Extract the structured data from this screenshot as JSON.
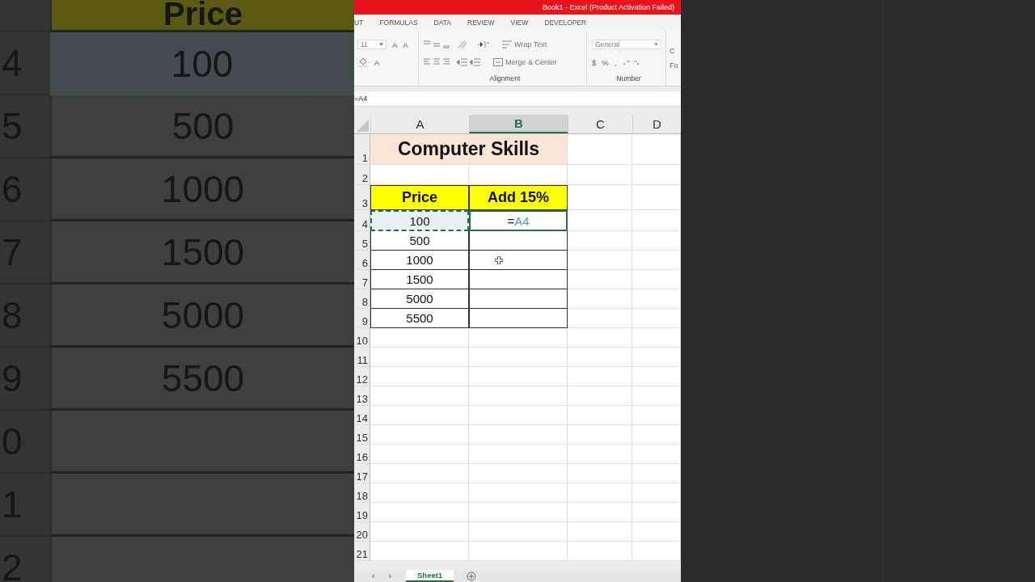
{
  "backdrop": {
    "header": "Price",
    "rows": [
      {
        "number": "4",
        "value": "100",
        "marquee": true
      },
      {
        "number": "5",
        "value": "500",
        "marquee": false
      },
      {
        "number": "6",
        "value": "1000",
        "marquee": false
      },
      {
        "number": "7",
        "value": "1500",
        "marquee": false
      },
      {
        "number": "8",
        "value": "5000",
        "marquee": false
      },
      {
        "number": "9",
        "value": "5500",
        "marquee": false
      },
      {
        "number": "0",
        "marquee": false
      },
      {
        "number": "1",
        "marquee": false
      },
      {
        "number": "2",
        "marquee": false
      }
    ]
  },
  "window": {
    "title": "Book1 -  Excel (Product Activation Failed)"
  },
  "ribbon_tabs": [
    {
      "label": "UT"
    },
    {
      "label": "FORMULAS"
    },
    {
      "label": "DATA"
    },
    {
      "label": "REVIEW"
    },
    {
      "label": "VIEW"
    },
    {
      "label": "DEVELOPER"
    }
  ],
  "ribbon": {
    "font_size": "11",
    "grow_font": "A",
    "shrink_font": "A",
    "font_color": "A",
    "wrap_text": "Wrap Text",
    "merge_center": "Merge & Center",
    "number_format": "General",
    "currency": "$",
    "percent": "%",
    "comma": ",",
    "alignment_label": "Alignment",
    "number_label": "Number",
    "cut_group": [
      "C",
      "Fo"
    ]
  },
  "formula_bar": {
    "value": "=A4"
  },
  "columns": [
    {
      "label": "A",
      "selected": false
    },
    {
      "label": "B",
      "selected": true
    },
    {
      "label": "C",
      "selected": false
    },
    {
      "label": "D",
      "selected": false
    }
  ],
  "title_cell": "Computer Skills",
  "table": {
    "headers": [
      "Price",
      "Add 15%"
    ],
    "rows": [
      {
        "price": "100",
        "marquee": true,
        "active": true,
        "formula": {
          "sign": "=",
          "ref": "A4"
        }
      },
      {
        "price": "500",
        "marquee": false,
        "active": false
      },
      {
        "price": "1000",
        "marquee": false,
        "active": false
      },
      {
        "price": "1500",
        "marquee": false,
        "active": false
      },
      {
        "price": "5000",
        "marquee": false,
        "active": false
      },
      {
        "price": "5500",
        "marquee": false,
        "active": false
      }
    ]
  },
  "row_numbers": [
    "1",
    "2",
    "3",
    "4",
    "5",
    "6",
    "7",
    "8",
    "9",
    "10",
    "11",
    "12",
    "13",
    "14",
    "15",
    "16",
    "17",
    "18",
    "19",
    "20",
    "21"
  ],
  "sheet_tabs": [
    {
      "label": "Sheet1",
      "selected": true
    }
  ]
}
